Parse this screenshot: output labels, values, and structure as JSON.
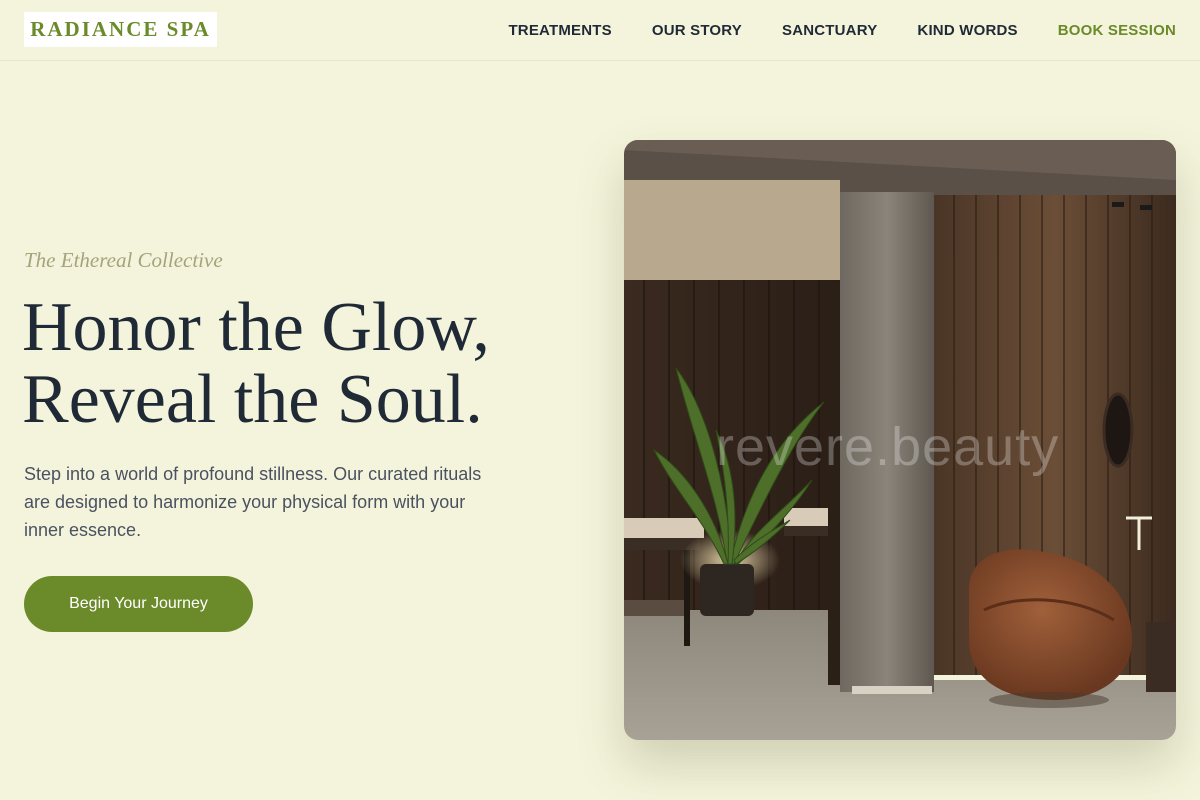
{
  "brand": {
    "logo_text": "RADIANCE SPA"
  },
  "nav": {
    "items": [
      {
        "label": "TREATMENTS"
      },
      {
        "label": "OUR STORY"
      },
      {
        "label": "SANCTUARY"
      },
      {
        "label": "KIND WORDS"
      }
    ],
    "book_label": "BOOK SESSION"
  },
  "hero": {
    "eyebrow": "The Ethereal Collective",
    "headline_line1": "Honor the Glow,",
    "headline_line2": "Reveal the Soul.",
    "description": "Step into a world of profound stillness. Our curated rituals are designed to harmonize your physical form with your inner essence.",
    "cta_label": "Begin Your Journey",
    "image_watermark": "revere.beauty"
  },
  "colors": {
    "background": "#f4f4dc",
    "accent": "#6b8a2a",
    "text_dark": "#1f2a36"
  }
}
